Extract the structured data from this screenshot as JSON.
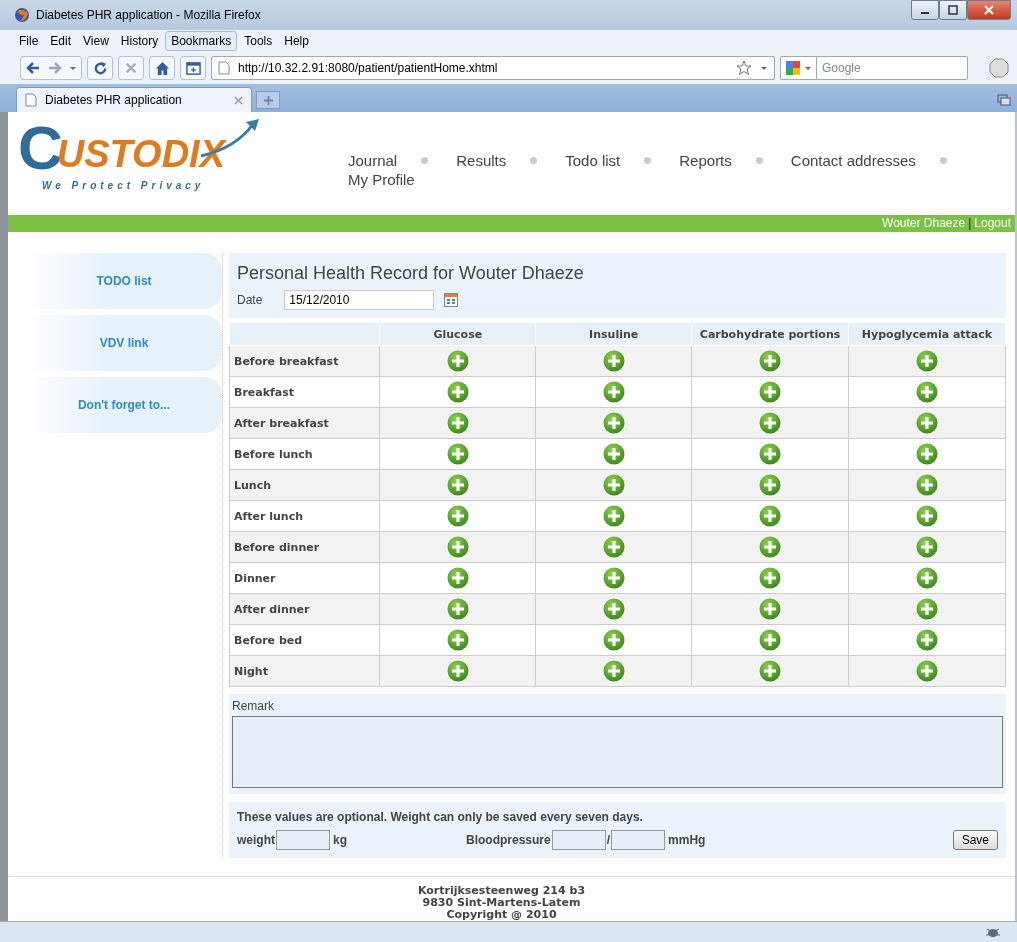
{
  "window": {
    "title": "Diabetes PHR application - Mozilla Firefox"
  },
  "menu": [
    {
      "label": "File",
      "selected": false
    },
    {
      "label": "Edit",
      "selected": false
    },
    {
      "label": "View",
      "selected": false
    },
    {
      "label": "History",
      "selected": false
    },
    {
      "label": "Bookmarks",
      "selected": true
    },
    {
      "label": "Tools",
      "selected": false
    },
    {
      "label": "Help",
      "selected": false
    }
  ],
  "address": {
    "value": "http://10.32.2.91:8080/patient/patientHome.xhtml"
  },
  "search": {
    "placeholder": "Google"
  },
  "tabs": [
    {
      "label": "Diabetes PHR application",
      "selected": true
    }
  ],
  "logo": {
    "initial": "C",
    "name": "USTODIX",
    "tagline": "We Protect Privacy"
  },
  "nav": [
    "Journal",
    "Results",
    "Todo list",
    "Reports",
    "Contact addresses",
    "My Profile"
  ],
  "user": {
    "name": "Wouter Dhaeze",
    "separator": "|",
    "logout": "Logout"
  },
  "sidebar": [
    "TODO list",
    "VDV link",
    "Don't forget to..."
  ],
  "record": {
    "title": "Personal Health Record for Wouter Dhaeze",
    "date_label": "Date",
    "date_value": "15/12/2010"
  },
  "table": {
    "columns": [
      "Glucose",
      "Insuline",
      "Carbohydrate portions",
      "Hypoglycemia attack"
    ],
    "rows": [
      "Before breakfast",
      "Breakfast",
      "After breakfast",
      "Before lunch",
      "Lunch",
      "After lunch",
      "Before dinner",
      "Dinner",
      "After dinner",
      "Before bed",
      "Night"
    ]
  },
  "remark": {
    "label": "Remark"
  },
  "optional": {
    "note": "These values are optional. Weight can only be saved every seven days.",
    "weight_label": "weight",
    "weight_unit": "kg",
    "bp_label": "Bloodpressure",
    "bp_separator": "/",
    "bp_unit": "mmHg",
    "save": "Save"
  },
  "footer": [
    "Kortrijksesteenweg 214 b3",
    "9830 Sint-Martens-Latem",
    "Copyright @ 2010"
  ]
}
